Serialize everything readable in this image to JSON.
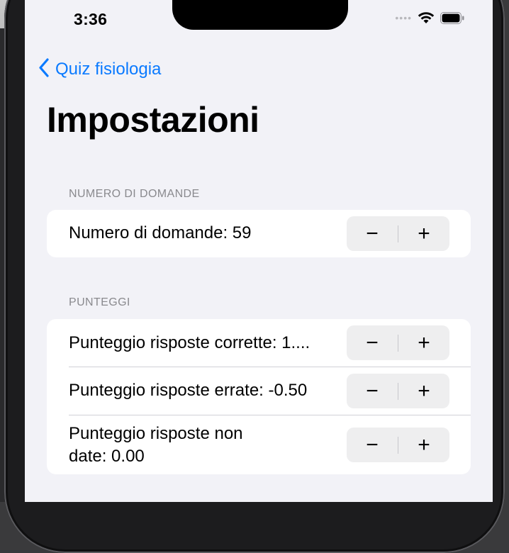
{
  "status_bar": {
    "time": "3:36",
    "icons": [
      "signal-dots-icon",
      "wifi-icon",
      "battery-icon"
    ]
  },
  "navigation": {
    "back_label": "Quiz fisiologia",
    "back_icon": "chevron-left-icon",
    "title": "Impostazioni"
  },
  "sections": [
    {
      "header": "NUMERO DI DOMANDE",
      "rows": [
        {
          "label": "Numero di domande: 59",
          "decrement": "−",
          "increment": "+"
        }
      ]
    },
    {
      "header": "PUNTEGGI",
      "rows": [
        {
          "label": "Punteggio risposte corrette: 1....",
          "decrement": "−",
          "increment": "+"
        },
        {
          "label": "Punteggio risposte errate: -0.50",
          "decrement": "−",
          "increment": "+"
        },
        {
          "label_line1": "Punteggio risposte non",
          "label_line2": "date: 0.00",
          "decrement": "−",
          "increment": "+"
        }
      ]
    }
  ],
  "colors": {
    "accent": "#0a7aff",
    "background": "#f2f2f7",
    "card": "#ffffff",
    "secondary_text": "#8a8a8e"
  }
}
